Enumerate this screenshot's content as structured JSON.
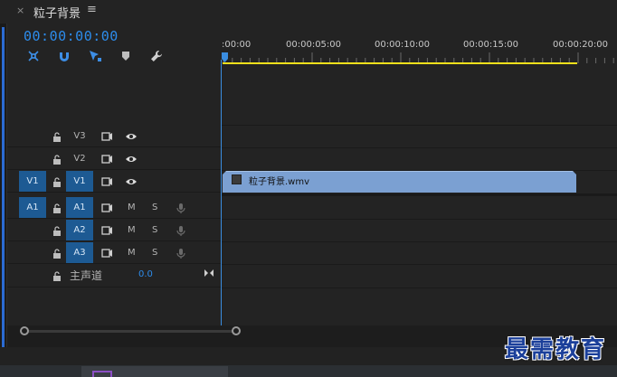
{
  "panel": {
    "close_glyph": "×",
    "title": "粒子背景",
    "menu_glyph": "≡"
  },
  "timecode": "00:00:00:00",
  "tools": [
    "nest-sequence-icon",
    "snap-magnet-icon",
    "linked-selection-icon",
    "add-marker-icon",
    "settings-wrench-icon"
  ],
  "ruler": {
    "labels": [
      ":00:00",
      "00:00:05:00",
      "00:00:10:00",
      "00:00:15:00",
      "00:00:20:00"
    ],
    "workarea_color": "#f2e01b"
  },
  "video_tracks": [
    {
      "name": "V3",
      "source_target": "",
      "active": false
    },
    {
      "name": "V2",
      "source_target": "",
      "active": false
    },
    {
      "name": "V1",
      "source_target": "V1",
      "active": true
    }
  ],
  "audio_tracks": [
    {
      "name": "A1",
      "source_target": "A1",
      "mute": "M",
      "solo": "S"
    },
    {
      "name": "A2",
      "source_target": "",
      "mute": "M",
      "solo": "S"
    },
    {
      "name": "A3",
      "source_target": "",
      "mute": "M",
      "solo": "S"
    }
  ],
  "master": {
    "label": "主声道",
    "value": "0.0"
  },
  "clip": {
    "name": "粒子背景.wmv",
    "color": "#7ba0d2"
  },
  "colors": {
    "accent_blue": "#2d8ceb",
    "target_blue": "#1d5a93"
  },
  "watermark": "最需教育"
}
